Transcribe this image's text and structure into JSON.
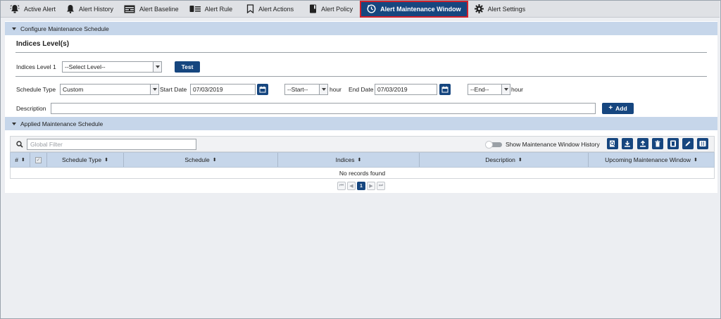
{
  "tabs": [
    {
      "label": "Active Alert",
      "icon": "alarm-icon"
    },
    {
      "label": "Alert History",
      "icon": "bell-icon"
    },
    {
      "label": "Alert Baseline",
      "icon": "baseline-icon"
    },
    {
      "label": "Alert Rule",
      "icon": "rule-list-icon"
    },
    {
      "label": "Alert Actions",
      "icon": "bookmark-icon"
    },
    {
      "label": "Alert Policy",
      "icon": "policy-book-icon"
    },
    {
      "label": "Alert Maintenance Window",
      "icon": "maintenance-icon",
      "active": true
    },
    {
      "label": "Alert Settings",
      "icon": "gear-icon"
    }
  ],
  "configure": {
    "section_title": "Configure Maintenance Schedule",
    "indices_heading": "Indices Level(s)",
    "indices_level_label": "Indices Level 1",
    "indices_level_value": "--Select Level--",
    "test_button": "Test",
    "schedule_type_label": "Schedule Type",
    "schedule_type_value": "Custom",
    "start_date_label": "Start Date",
    "start_date_value": "07/03/2019",
    "start_hour_value": "--Start--",
    "hour_label_1": "hour",
    "end_date_label": "End Date",
    "end_date_value": "07/03/2019",
    "end_hour_value": "--End--",
    "hour_label_2": "hour",
    "description_label": "Description",
    "description_value": "",
    "add_button": "Add"
  },
  "applied": {
    "section_title": "Applied Maintenance Schedule",
    "filter_placeholder": "Global Filter",
    "history_toggle_label": "Show Maintenance Window History",
    "columns": [
      "#",
      "",
      "Schedule Type",
      "Schedule",
      "Indices",
      "Description",
      "Upcoming Maintenance Window"
    ],
    "empty_message": "No records found",
    "current_page": "1"
  },
  "colors": {
    "accent": "#16467f",
    "active_tab_border": "#d0202b",
    "section_header": "#c6d6ea"
  }
}
